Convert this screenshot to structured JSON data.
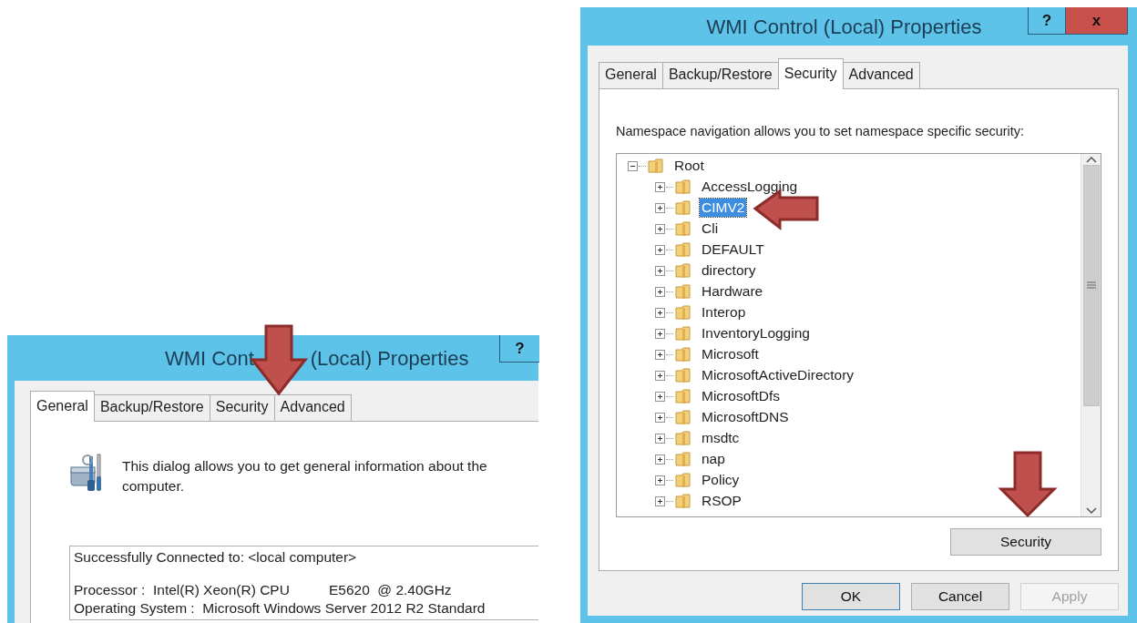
{
  "dialogs": [
    {
      "kind": "general",
      "title_parts": [
        "WMI Cont",
        "(Local) Properties"
      ],
      "help_button": "?",
      "tabs": [
        {
          "label": "General",
          "selected": true
        },
        {
          "label": "Backup/Restore",
          "selected": false
        },
        {
          "label": "Security",
          "selected": false
        },
        {
          "label": "Advanced",
          "selected": false
        }
      ],
      "description": "This dialog allows you to get general information about the\ncomputer.",
      "connection": "Successfully Connected to: <local computer>",
      "details": [
        "Processor :  Intel(R) Xeon(R) CPU          E5620  @ 2.40GHz",
        "Operating System :  Microsoft Windows Server 2012 R2 Standard"
      ]
    },
    {
      "kind": "security",
      "title": "WMI Control (Local) Properties",
      "help_button": "?",
      "close_button": "x",
      "tabs": [
        {
          "label": "General",
          "selected": false
        },
        {
          "label": "Backup/Restore",
          "selected": false
        },
        {
          "label": "Security",
          "selected": true
        },
        {
          "label": "Advanced",
          "selected": false
        }
      ],
      "hint": "Namespace navigation allows you to set namespace specific security:",
      "tree": [
        {
          "label": "Root",
          "expanded": true,
          "selected": false,
          "children": [
            {
              "label": "AccessLogging",
              "expanded": false,
              "selected": false
            },
            {
              "label": "CIMV2",
              "expanded": false,
              "selected": true
            },
            {
              "label": "Cli",
              "expanded": false,
              "selected": false
            },
            {
              "label": "DEFAULT",
              "expanded": false,
              "selected": false
            },
            {
              "label": "directory",
              "expanded": false,
              "selected": false
            },
            {
              "label": "Hardware",
              "expanded": false,
              "selected": false
            },
            {
              "label": "Interop",
              "expanded": false,
              "selected": false
            },
            {
              "label": "InventoryLogging",
              "expanded": false,
              "selected": false
            },
            {
              "label": "Microsoft",
              "expanded": false,
              "selected": false
            },
            {
              "label": "MicrosoftActiveDirectory",
              "expanded": false,
              "selected": false
            },
            {
              "label": "MicrosoftDfs",
              "expanded": false,
              "selected": false
            },
            {
              "label": "MicrosoftDNS",
              "expanded": false,
              "selected": false
            },
            {
              "label": "msdtc",
              "expanded": false,
              "selected": false
            },
            {
              "label": "nap",
              "expanded": false,
              "selected": false
            },
            {
              "label": "Policy",
              "expanded": false,
              "selected": false
            },
            {
              "label": "RSOP",
              "expanded": false,
              "selected": false
            }
          ]
        }
      ],
      "panel_button": "Security",
      "buttons": [
        {
          "label": "OK",
          "disabled": false
        },
        {
          "label": "Cancel",
          "disabled": false
        },
        {
          "label": "Apply",
          "disabled": true
        }
      ]
    }
  ]
}
